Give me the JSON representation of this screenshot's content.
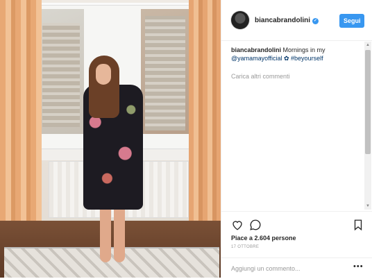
{
  "post": {
    "username": "biancabrandolini",
    "verified": true,
    "follow_label": "Segui",
    "caption": {
      "user": "biancabrandolini",
      "text_before": " Mornings in my ",
      "mention": "@yamamayofficial",
      "text_after": " ✿ #beyourself"
    },
    "load_more": "Carica altri commenti",
    "likes": "Piace a 2.604 persone",
    "date": "17 OTTOBRE",
    "comment_placeholder": "Aggiungi un commento...",
    "more_options": "•••"
  },
  "icons": {
    "like": "heart-icon",
    "comment": "comment-bubble-icon",
    "save": "bookmark-icon",
    "verified": "verified-badge-icon"
  },
  "colors": {
    "accent": "#3897f0",
    "text": "#262626",
    "muted": "#999999"
  }
}
